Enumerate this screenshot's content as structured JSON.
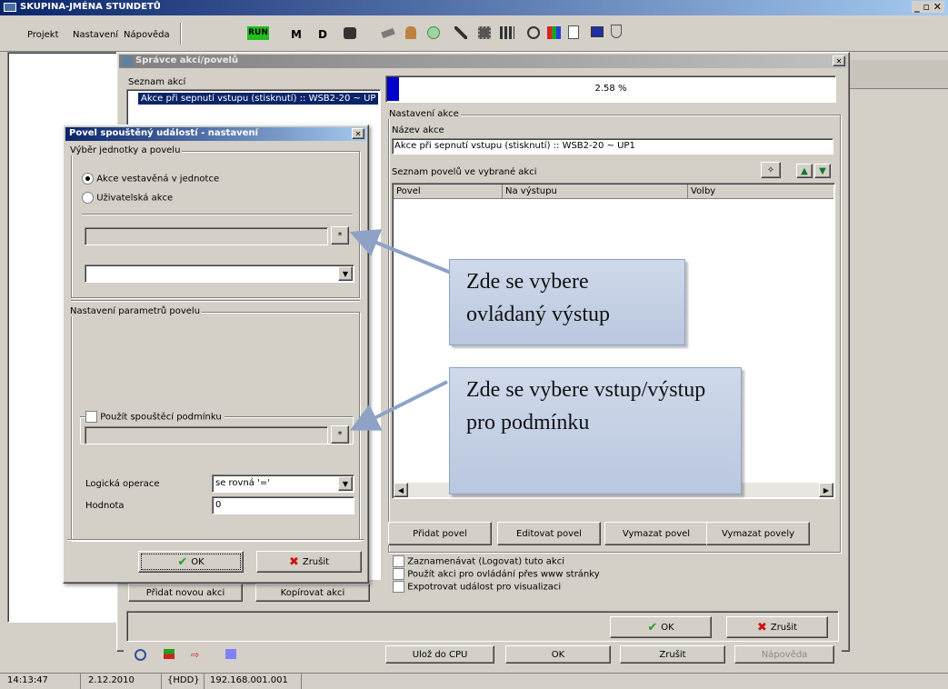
{
  "app": {
    "title": "SKUPINA-JMÉNA STUNDETŮ",
    "winbtns": "_ ▫ ✕"
  },
  "menu": {
    "items": [
      "Projekt",
      "Nastavení",
      "Nápověda"
    ],
    "run": "RUN",
    "m": "M",
    "d": "D"
  },
  "manager": {
    "title": "Správce akcí/povelů",
    "close": "✕",
    "list_label": "Seznam akcí",
    "list_item": "Akce při sepnutí vstupu (stisknutí) :: WSB2-20 ~ UP",
    "progress_text": "2.58 %",
    "progress": 0.0258,
    "settings_group": "Nastavení akce",
    "name_label": "Název akce",
    "name_value": "Akce při sepnutí vstupu (stisknutí) :: WSB2-20 ~ UP1",
    "commands_label": "Seznam povelů ve vybrané akci",
    "columns": [
      "Povel",
      "Na výstupu",
      "Volby"
    ],
    "btn_add": "Přidat povel",
    "btn_edit": "Editovat povel",
    "btn_delete": "Vymazat povel",
    "btn_delete_all": "Vymazat povely",
    "chk_log": "Zaznamenávat (Logovat) tuto akci",
    "chk_www": "Použít akci pro ovládání přes www stránky",
    "chk_vis": "Expotrovat událost pro visualizaci",
    "ok": "OK",
    "cancel": "Zrušit",
    "btn_new_action": "Přidat novou akci",
    "btn_copy_action": "Kopírovat akci"
  },
  "dialog": {
    "title": "Povel spouštěný událostí - nastavení",
    "close": "✕",
    "group1": "Výběr jednotky a povelu",
    "radio1": "Akce vestavěná v jednotce",
    "radio2": "Uživatelská akce",
    "browse": "*",
    "dropdown_arrow": "▼",
    "group2": "Nastavení parametrů povelu",
    "chk_condition": "Použít spouštěcí podmínku",
    "logic_label": "Logická operace",
    "logic_value": "se rovná '='",
    "value_label": "Hodnota",
    "value_value": "0",
    "ok": "OK",
    "cancel": "Zrušit"
  },
  "callouts": [
    "Zde se vybere ovládaný výstup",
    "Zde se vybere vstup/výstup pro podmínku"
  ],
  "bottom": {
    "save_cpu": "Ulož do CPU",
    "ok": "OK",
    "cancel": "Zrušit",
    "help": "Nápověda"
  },
  "status": {
    "time": "14:13:47",
    "date": "2.12.2010",
    "hdd": "{HDD}",
    "ip": "192.168.001.001"
  },
  "colors": {
    "title_blue": "#0a246a",
    "selection": "#0a246a",
    "progress": "#0000cc",
    "callout": "#c3cfe4",
    "arrow": "#8ea2c6"
  }
}
